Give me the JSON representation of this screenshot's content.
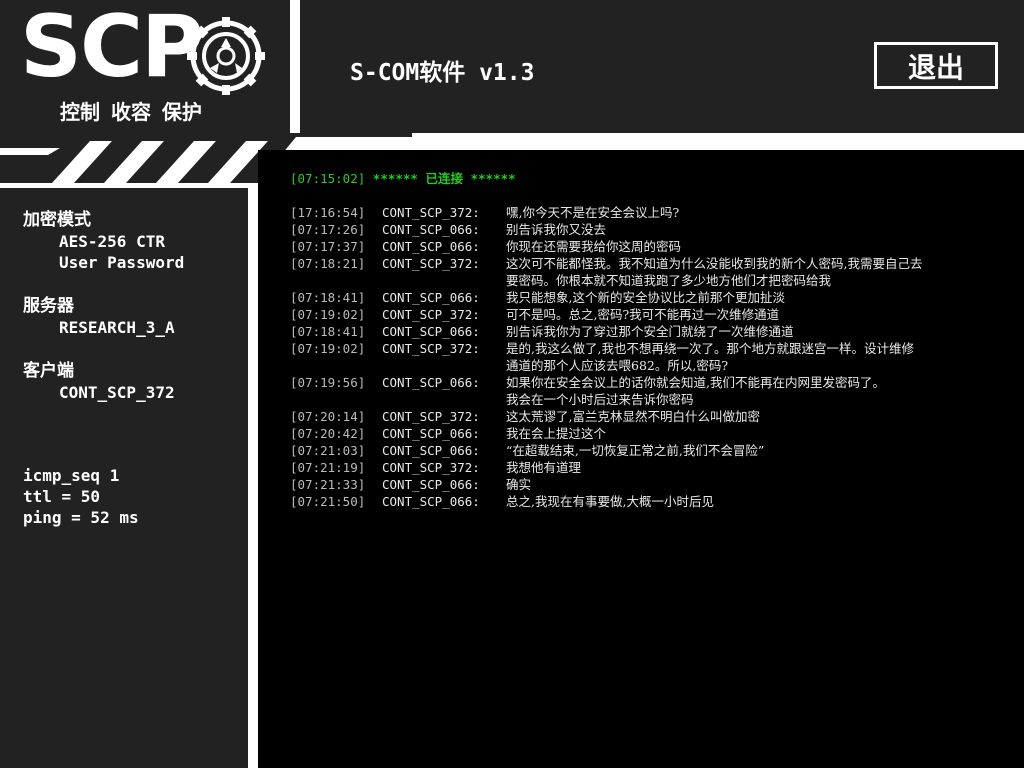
{
  "logo": {
    "text": "SCP",
    "tagline": "控制 收容 保护",
    "emblem_icon": "scp-foundation-emblem-icon"
  },
  "header": {
    "title": "S-COM软件 v1.3",
    "exit_label": "退出"
  },
  "sidebar": {
    "encryption_heading": "加密模式",
    "encryption_values": [
      "AES-256 CTR",
      "User Password"
    ],
    "server_heading": "服务器",
    "server_value": "RESEARCH_3_A",
    "client_heading": "客户端",
    "client_value": "CONT_SCP_372",
    "network": [
      "icmp_seq 1",
      "ttl = 50",
      "ping = 52 ms"
    ]
  },
  "console": {
    "status_ts": "[07:15:02]",
    "status_text": "****** 已连接 ******",
    "messages": [
      {
        "ts": "[17:16:54]",
        "user": "CONT_SCP_372:",
        "text": "嘿,你今天不是在安全会议上吗?"
      },
      {
        "ts": "[07:17:26]",
        "user": "CONT_SCP_066:",
        "text": "别告诉我你又没去"
      },
      {
        "ts": "[07:17:37]",
        "user": "CONT_SCP_066:",
        "text": "你现在还需要我给你这周的密码"
      },
      {
        "ts": "[07:18:21]",
        "user": "CONT_SCP_372:",
        "text": "这次可不能都怪我。我不知道为什么没能收到我的新个人密码,我需要自己去\n要密码。你根本就不知道我跑了多少地方他们才把密码给我"
      },
      {
        "ts": "[07:18:41]",
        "user": "CONT_SCP_066:",
        "text": "我只能想象,这个新的安全协议比之前那个更加扯淡"
      },
      {
        "ts": "[07:19:02]",
        "user": "CONT_SCP_372:",
        "text": "可不是吗。总之,密码?我可不能再过一次维修通道"
      },
      {
        "ts": "[07:18:41]",
        "user": "CONT_SCP_066:",
        "text": "别告诉我你为了穿过那个安全门就绕了一次维修通道"
      },
      {
        "ts": "[07:19:02]",
        "user": "CONT_SCP_372:",
        "text": "是的,我这么做了,我也不想再绕一次了。那个地方就跟迷宫一样。设计维修\n通道的那个人应该去喂682。所以,密码?"
      },
      {
        "ts": "[07:19:56]",
        "user": "CONT_SCP_066:",
        "text": "如果你在安全会议上的话你就会知道,我们不能再在内网里发密码了。\n我会在一个小时后过来告诉你密码"
      },
      {
        "ts": "[07:20:14]",
        "user": "CONT_SCP_372:",
        "text": "这太荒谬了,富兰克林显然不明白什么叫做加密"
      },
      {
        "ts": "[07:20:42]",
        "user": "CONT_SCP_066:",
        "text": "我在会上提过这个"
      },
      {
        "ts": "[07:21:03]",
        "user": "CONT_SCP_066:",
        "text": "“在超载结束,一切恢复正常之前,我们不会冒险”"
      },
      {
        "ts": "[07:21:19]",
        "user": "CONT_SCP_372:",
        "text": "我想他有道理"
      },
      {
        "ts": "[07:21:33]",
        "user": "CONT_SCP_066:",
        "text": "确实"
      },
      {
        "ts": "[07:21:50]",
        "user": "CONT_SCP_066:",
        "text": "总之,我现在有事要做,大概一小时后见"
      }
    ]
  }
}
